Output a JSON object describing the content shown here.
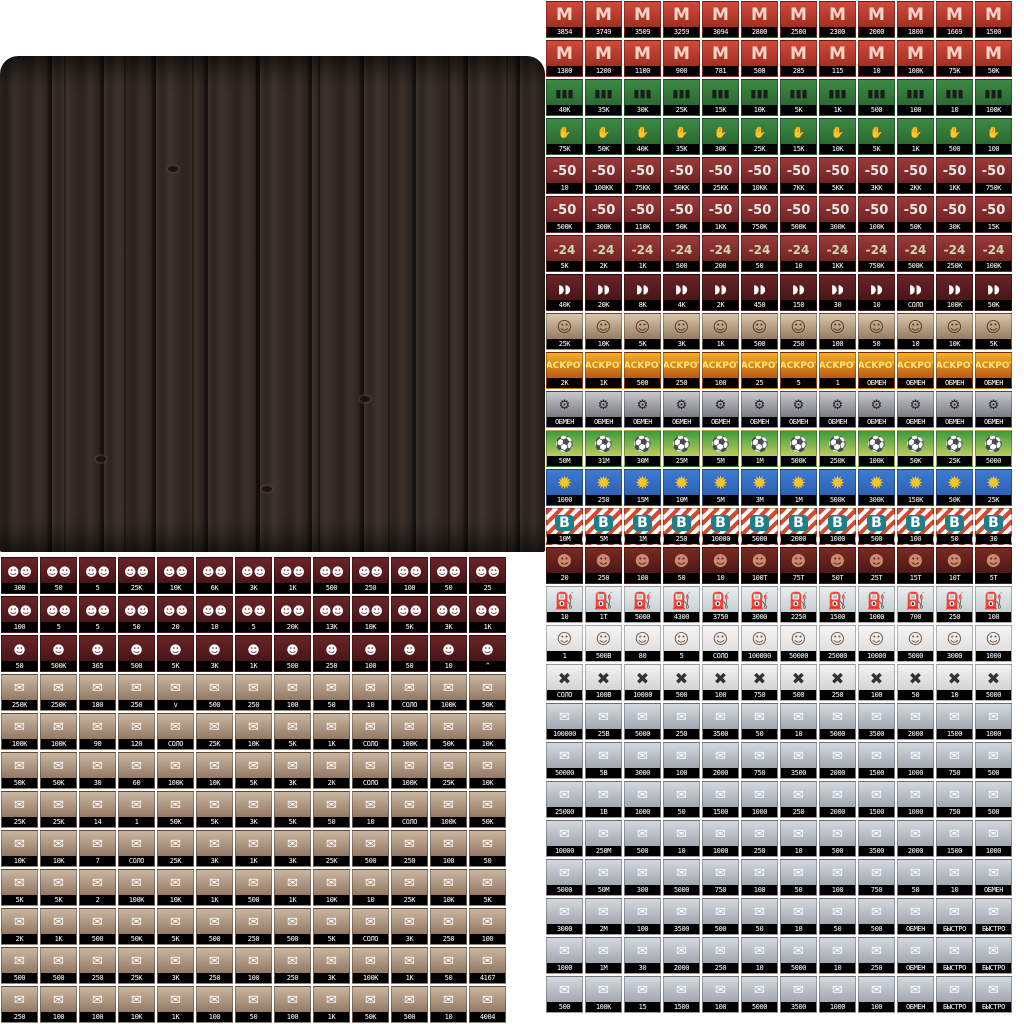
{
  "atlas": {
    "right_rows": [
      {
        "kind": "red",
        "icon": "M",
        "labels": [
          "3854",
          "3749",
          "3509",
          "3259",
          "3094",
          "2800",
          "2500",
          "2300",
          "2000",
          "1800",
          "1669",
          "1500"
        ]
      },
      {
        "kind": "red",
        "icon": "M",
        "labels": [
          "1300",
          "1200",
          "1100",
          "900",
          "781",
          "500",
          "285",
          "115",
          "10",
          "100K",
          "75K",
          "50K"
        ]
      },
      {
        "kind": "green",
        "icon": "▮▮▮",
        "labels": [
          "40K",
          "35K",
          "30K",
          "25K",
          "15K",
          "10K",
          "5K",
          "1K",
          "500",
          "100",
          "10",
          "100K"
        ]
      },
      {
        "kind": "green",
        "icon": "✋",
        "labels": [
          "75K",
          "50K",
          "40K",
          "35K",
          "30K",
          "25K",
          "15K",
          "10K",
          "5K",
          "1K",
          "500",
          "100"
        ]
      },
      {
        "kind": "coin",
        "icon": "-50",
        "labels": [
          "10",
          "100KK",
          "75KK",
          "50KK",
          "25KK",
          "10KK",
          "7KK",
          "5KK",
          "3KK",
          "2KK",
          "1KK",
          "750K"
        ]
      },
      {
        "kind": "coin",
        "icon": "-50",
        "labels": [
          "500K",
          "300K",
          "110K",
          "50K",
          "1KK",
          "750K",
          "500K",
          "300K",
          "100K",
          "50K",
          "30K",
          "15K"
        ]
      },
      {
        "kind": "money",
        "icon": "-24",
        "labels": [
          "5K",
          "2K",
          "1K",
          "500",
          "200",
          "50",
          "10",
          "1KK",
          "750K",
          "500K",
          "250K",
          "100K",
          "60K"
        ]
      },
      {
        "kind": "ufc",
        "icon": "◗◗",
        "labels": [
          "40K",
          "20K",
          "8K",
          "4K",
          "2K",
          "450",
          "150",
          "30",
          "10",
          "СОЛО",
          "100K",
          "50K"
        ]
      },
      {
        "kind": "face",
        "icon": "☺",
        "labels": [
          "25K",
          "10K",
          "5K",
          "3K",
          "1K",
          "500",
          "250",
          "100",
          "50",
          "10",
          "10K",
          "5K"
        ]
      },
      {
        "kind": "jack",
        "icon": "JACKPOT",
        "labels": [
          "2K",
          "1K",
          "500",
          "250",
          "100",
          "25",
          "5",
          "1",
          "ОБМЕН",
          "ОБМЕН",
          "ОБМЕН",
          "ОБМЕН"
        ]
      },
      {
        "kind": "obmen",
        "icon": "⚙",
        "labels": [
          "ОБМЕН",
          "ОБМЕН",
          "ОБМЕН",
          "ОБМЕН",
          "ОБМЕН",
          "ОБМЕН",
          "ОБМЕН",
          "ОБМЕН",
          "ОБМЕН",
          "ОБМЕН",
          "ОБМЕН",
          "ОБМЕН"
        ]
      },
      {
        "kind": "ball",
        "icon": "⚽",
        "labels": [
          "50M",
          "31M",
          "30M",
          "25M",
          "5M",
          "1M",
          "500K",
          "250K",
          "100K",
          "50K",
          "25K",
          "5000"
        ]
      },
      {
        "kind": "sun",
        "icon": "✹",
        "labels": [
          "1000",
          "250",
          "15M",
          "10M",
          "5M",
          "3M",
          "1M",
          "500K",
          "300K",
          "150K",
          "50K",
          "25K"
        ]
      },
      {
        "kind": "bet",
        "icon": "B",
        "labels": [
          "10M",
          "5M",
          "1M",
          "250",
          "10000",
          "5000",
          "2000",
          "1000",
          "500",
          "100",
          "50",
          "30"
        ]
      },
      {
        "kind": "dark",
        "icon": "☻",
        "labels": [
          "20",
          "250",
          "100",
          "50",
          "10",
          "100T",
          "75T",
          "50T",
          "25T",
          "15T",
          "10T",
          "5T"
        ]
      },
      {
        "kind": "can",
        "icon": "⛽",
        "labels": [
          "10",
          "1T",
          "5000",
          "4300",
          "3750",
          "3000",
          "2250",
          "1500",
          "1000",
          "700",
          "250",
          "100"
        ]
      },
      {
        "kind": "man",
        "icon": "☺",
        "labels": [
          "1",
          "500B",
          "80",
          "5",
          "СОЛО",
          "100000",
          "50000",
          "25000",
          "10000",
          "5000",
          "3000",
          "1000"
        ]
      },
      {
        "kind": "gear",
        "icon": "✖",
        "labels": [
          "СОЛО",
          "100B",
          "10000",
          "500",
          "100",
          "750",
          "500",
          "250",
          "100",
          "50",
          "10",
          "5000"
        ]
      },
      {
        "kind": "bldg",
        "icon": "✉",
        "labels": [
          "100000",
          "25B",
          "5000",
          "250",
          "3500",
          "50",
          "10",
          "5000",
          "3500",
          "2000",
          "1500",
          "1000"
        ]
      },
      {
        "kind": "bldg",
        "icon": "✉",
        "labels": [
          "50000",
          "5B",
          "3000",
          "100",
          "2000",
          "750",
          "3500",
          "2000",
          "1500",
          "1000",
          "750",
          "500"
        ]
      },
      {
        "kind": "bldg",
        "icon": "✉",
        "labels": [
          "25000",
          "1B",
          "1000",
          "50",
          "1500",
          "1000",
          "250",
          "2000",
          "1500",
          "1000",
          "750",
          "500"
        ]
      },
      {
        "kind": "bldg",
        "icon": "✉",
        "labels": [
          "10000",
          "250M",
          "500",
          "10",
          "1000",
          "250",
          "10",
          "500",
          "3500",
          "2000",
          "1500",
          "1000"
        ]
      },
      {
        "kind": "bldg",
        "icon": "✉",
        "labels": [
          "5000",
          "50M",
          "300",
          "5000",
          "750",
          "100",
          "50",
          "100",
          "750",
          "50",
          "10",
          "ОБМЕН"
        ]
      },
      {
        "kind": "bldg",
        "icon": "✉",
        "labels": [
          "3000",
          "2M",
          "100",
          "3500",
          "500",
          "50",
          "10",
          "50",
          "500",
          "ОБМЕН",
          "БЫСТРО",
          "БЫСТРО"
        ]
      },
      {
        "kind": "bldg",
        "icon": "✉",
        "labels": [
          "1000",
          "1M",
          "30",
          "2000",
          "250",
          "10",
          "5000",
          "10",
          "250",
          "ОБМЕН",
          "БЫСТРО",
          "БЫСТРО"
        ]
      },
      {
        "kind": "bldg",
        "icon": "✉",
        "labels": [
          "500",
          "100K",
          "15",
          "1500",
          "100",
          "5000",
          "3500",
          "1000",
          "100",
          "ОБМЕН",
          "БЫСТРО",
          "БЫСТРО"
        ]
      }
    ],
    "left_rows": [
      {
        "kind": "ufc",
        "icon": "☻☻",
        "labels": [
          "300",
          "50",
          "5",
          "25K",
          "10K",
          "6K",
          "3K",
          "1K",
          "500",
          "250",
          "100",
          "50",
          "25"
        ]
      },
      {
        "kind": "ufc",
        "icon": "☻☻",
        "labels": [
          "100",
          "5",
          "5",
          "50",
          "20",
          "10",
          "5",
          "20K",
          "13K",
          "10K",
          "5K",
          "3K",
          "1K"
        ]
      },
      {
        "kind": "ufc",
        "icon": "☻",
        "labels": [
          "50",
          "500K",
          "365",
          "500",
          "5K",
          "3K",
          "1K",
          "500",
          "250",
          "100",
          "50",
          "10",
          "^"
        ]
      },
      {
        "kind": "card",
        "icon": "✉",
        "labels": [
          "250K",
          "250K",
          "180",
          "250",
          "v",
          "500",
          "250",
          "100",
          "50",
          "10",
          "СОЛО",
          "100K",
          "50K"
        ]
      },
      {
        "kind": "card",
        "icon": "✉",
        "labels": [
          "100K",
          "100K",
          "90",
          "120",
          "СОЛО",
          "25K",
          "10K",
          "5K",
          "1K",
          "СОЛО",
          "100K",
          "50K",
          "10K"
        ]
      },
      {
        "kind": "card",
        "icon": "✉",
        "labels": [
          "50K",
          "50K",
          "30",
          "60",
          "100K",
          "10K",
          "5K",
          "3K",
          "2K",
          "СОЛО",
          "100K",
          "25K",
          "10K"
        ]
      },
      {
        "kind": "card",
        "icon": "✉",
        "labels": [
          "25K",
          "25K",
          "14",
          "1",
          "50K",
          "5K",
          "3K",
          "5K",
          "50",
          "10",
          "СОЛО",
          "100K",
          "50K"
        ]
      },
      {
        "kind": "card",
        "icon": "✉",
        "labels": [
          "10K",
          "10K",
          "7",
          "СОЛО",
          "25K",
          "3K",
          "1K",
          "3K",
          "25K",
          "500",
          "250",
          "100",
          "50"
        ]
      },
      {
        "kind": "card",
        "icon": "✉",
        "labels": [
          "5K",
          "5K",
          "2",
          "100K",
          "10K",
          "1K",
          "500",
          "1K",
          "10K",
          "10",
          "25K",
          "10K",
          "5K"
        ]
      },
      {
        "kind": "card",
        "icon": "✉",
        "labels": [
          "2K",
          "1K",
          "500",
          "50K",
          "5K",
          "500",
          "250",
          "500",
          "5K",
          "СОЛО",
          "3K",
          "250",
          "100"
        ]
      },
      {
        "kind": "card",
        "icon": "✉",
        "labels": [
          "500",
          "500",
          "250",
          "25K",
          "3K",
          "250",
          "100",
          "250",
          "3K",
          "100K",
          "1K",
          "50",
          "4167"
        ]
      },
      {
        "kind": "card",
        "icon": "✉",
        "labels": [
          "250",
          "100",
          "100",
          "10K",
          "1K",
          "100",
          "50",
          "100",
          "1K",
          "50K",
          "500",
          "10",
          "4004"
        ]
      }
    ]
  },
  "colors": {
    "background": "#ffffff",
    "wood": "#2e2721",
    "label_bg": "#000000",
    "label_fg": "#ffffff"
  }
}
